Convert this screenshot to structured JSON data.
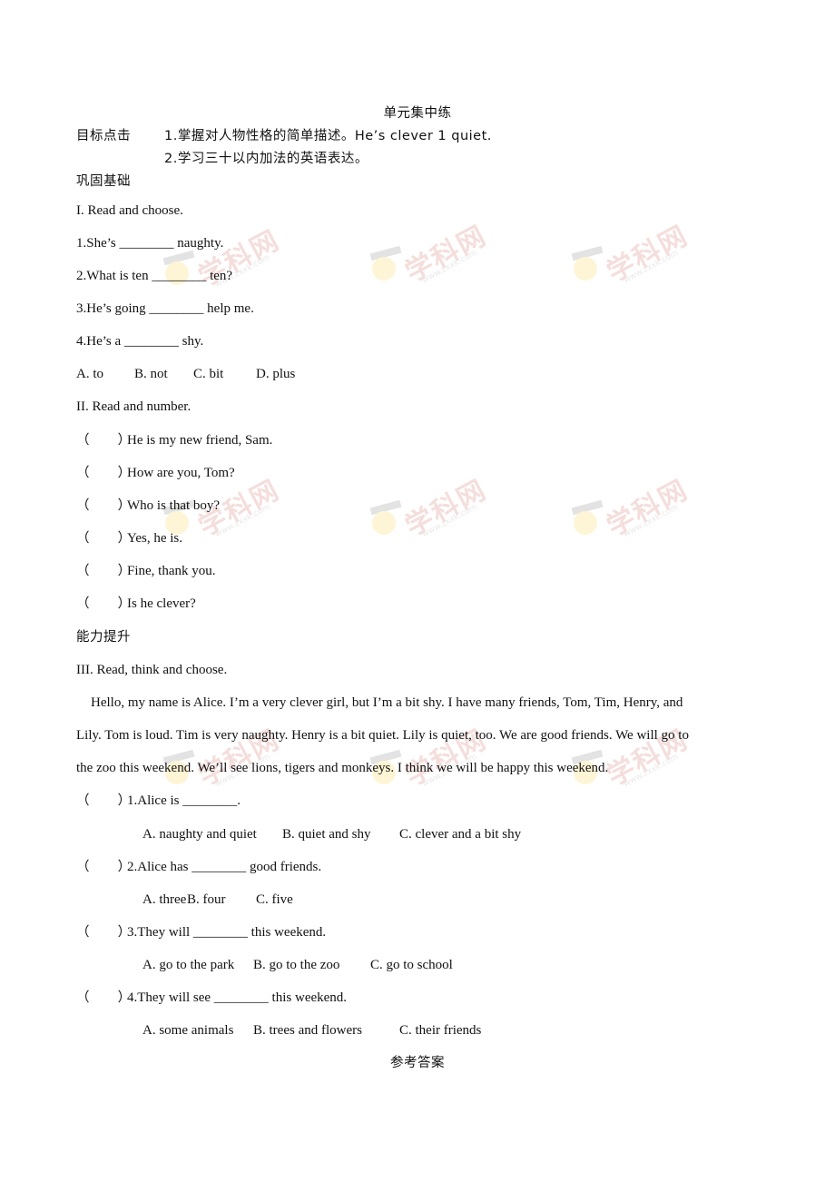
{
  "document": {
    "title": "单元集中练",
    "objectives": {
      "label": "目标点击",
      "items": [
        "1.掌握对人物性格的简单描述。He’s clever 1 quiet.",
        "2.学习三十以内加法的英语表达。"
      ]
    },
    "sections": {
      "basics_heading": "巩固基础",
      "part1": {
        "heading": "I. Read and choose.",
        "questions": [
          "1.She’s ________ naughty.",
          "2.What is ten ________ ten?",
          "3.He’s going ________ help me.",
          "4.He’s a ________ shy."
        ],
        "options": [
          "A. to",
          "B. not",
          "C. bit",
          "D. plus"
        ]
      },
      "part2": {
        "heading": "II. Read and number.",
        "paren": "（      ）",
        "items": [
          "He is my new friend, Sam.",
          "How are you, Tom?",
          "Who is that boy?",
          "Yes, he is.",
          "Fine, thank you.",
          "Is he clever?"
        ]
      },
      "advanced_heading": "能力提升",
      "part3": {
        "heading": "III. Read, think and choose.",
        "passage": [
          "Hello, my name is Alice. I’m a very clever girl, but I’m a bit shy. I have many friends, Tom, Tim, Henry, and",
          "Lily. Tom is loud. Tim is very naughty. Henry is a bit quiet. Lily is quiet, too. We are good friends. We will go to",
          "the zoo this weekend. We’ll see lions, tigers and monkeys. I think we will be happy this weekend."
        ],
        "questions": [
          {
            "stem": "1.Alice is ________.",
            "options": [
              "A. naughty and quiet",
              "B. quiet and shy",
              "C. clever and a bit shy"
            ]
          },
          {
            "stem": "2.Alice has ________ good friends.",
            "options": [
              "A. three",
              "B. four",
              "C. five"
            ]
          },
          {
            "stem": "3.They will ________ this weekend.",
            "options": [
              "A. go to the park",
              "B. go to the zoo",
              "C. go to school"
            ]
          },
          {
            "stem": "4.They will see ________ this weekend.",
            "options": [
              "A. some animals",
              "B. trees and flowers",
              "C. their friends"
            ]
          }
        ]
      },
      "answers_heading": "参考答案"
    },
    "watermark": {
      "text": "学科网",
      "url": "www.zxxk.com"
    }
  }
}
